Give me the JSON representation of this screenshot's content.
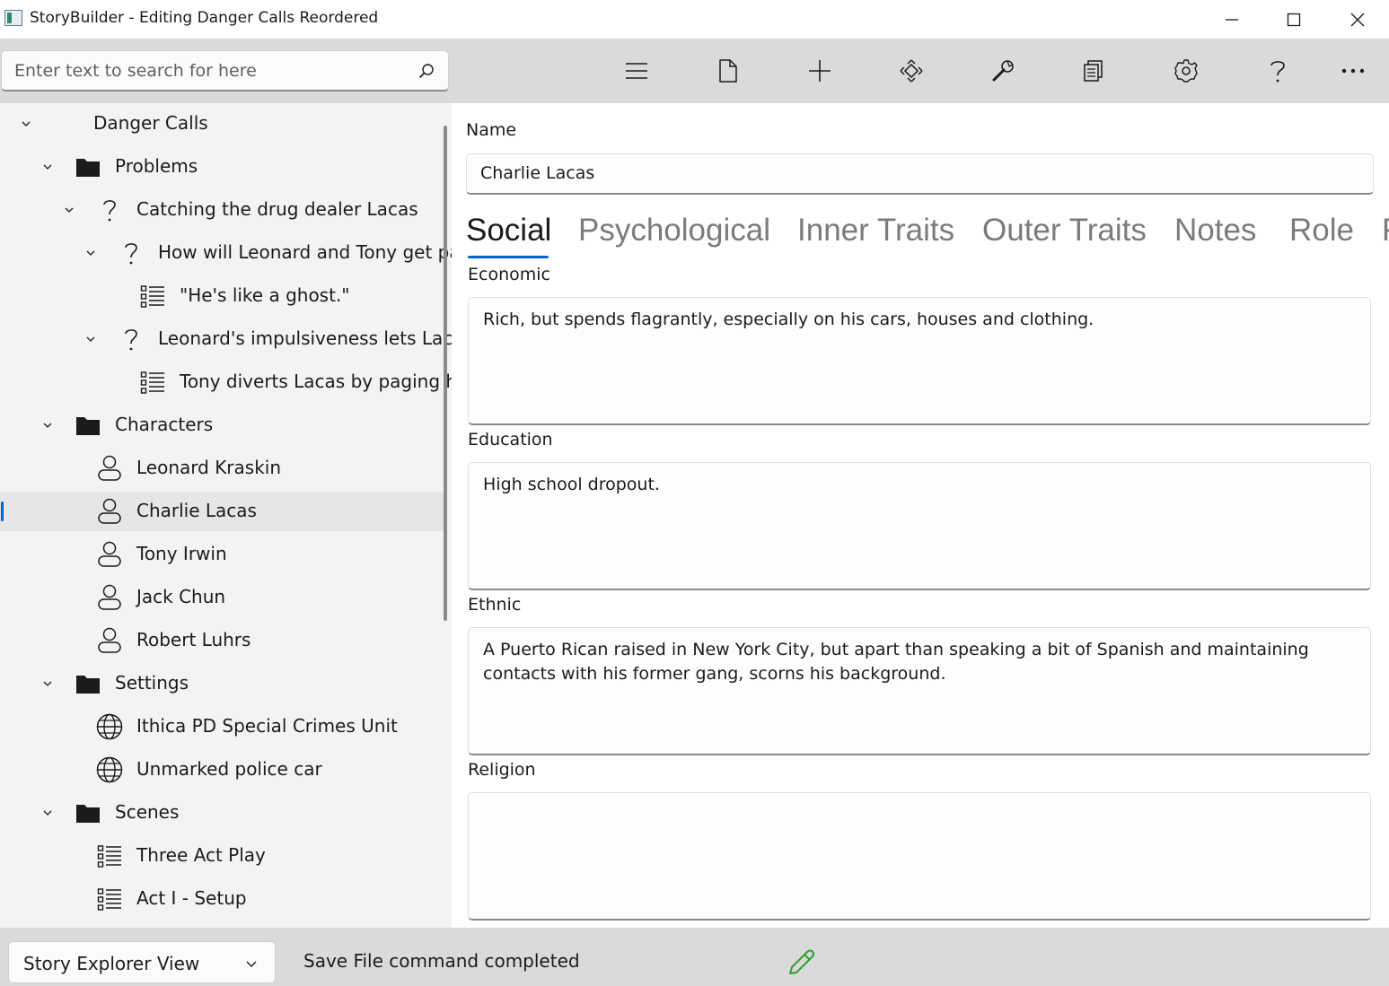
{
  "window": {
    "title": "StoryBuilder - Editing Danger Calls Reordered",
    "app_icon": "storybuilder-app-icon",
    "controls": [
      "minimize-icon",
      "maximize-icon",
      "close-icon"
    ]
  },
  "search": {
    "placeholder": "Enter text to search for here",
    "value": "",
    "icon": "search-icon"
  },
  "toolbar": {
    "buttons": [
      "menu-icon",
      "file-icon",
      "add-icon",
      "move-icon",
      "tools-icon",
      "reports-icon",
      "settings-icon",
      "help-icon",
      "more-icon"
    ]
  },
  "tree": {
    "nodes": [
      {
        "label": "Danger Calls",
        "icon": "none",
        "expanded": true
      },
      {
        "label": "Problems",
        "icon": "folder-icon",
        "expanded": true
      },
      {
        "label": "Catching the drug dealer Lacas",
        "icon": "question-icon",
        "expanded": true
      },
      {
        "label": "How will Leonard and Tony get past Lacas",
        "icon": "question-icon",
        "expanded": true
      },
      {
        "label": "\"He's like a ghost.\"",
        "icon": "scene-list-icon"
      },
      {
        "label": "Leonard's impulsiveness lets Lacas escape",
        "icon": "question-icon",
        "expanded": true
      },
      {
        "label": "Tony diverts Lacas by paging him",
        "icon": "scene-list-icon"
      },
      {
        "label": "Characters",
        "icon": "folder-icon",
        "expanded": true
      },
      {
        "label": "Leonard Kraskin",
        "icon": "person-icon"
      },
      {
        "label": "Charlie Lacas",
        "icon": "person-icon",
        "selected": true
      },
      {
        "label": "Tony Irwin",
        "icon": "person-icon"
      },
      {
        "label": "Jack Chun",
        "icon": "person-icon"
      },
      {
        "label": "Robert Luhrs",
        "icon": "person-icon"
      },
      {
        "label": "Settings",
        "icon": "folder-icon",
        "expanded": true
      },
      {
        "label": "Ithica PD Special Crimes Unit",
        "icon": "globe-icon"
      },
      {
        "label": "Unmarked police car",
        "icon": "globe-icon"
      },
      {
        "label": "Scenes",
        "icon": "folder-icon",
        "expanded": true
      },
      {
        "label": "Three Act Play",
        "icon": "scene-list-icon"
      },
      {
        "label": "Act I - Setup",
        "icon": "scene-list-icon"
      }
    ]
  },
  "editor": {
    "name_label": "Name",
    "name_value": "Charlie Lacas",
    "tabs": [
      {
        "label": "Social",
        "active": true
      },
      {
        "label": "Psychological"
      },
      {
        "label": "Inner Traits"
      },
      {
        "label": "Outer Traits"
      },
      {
        "label": "Notes"
      },
      {
        "label": "Role"
      },
      {
        "label": "F"
      }
    ],
    "fields": [
      {
        "label": "Economic",
        "value": "Rich, but spends flagrantly, especially on his cars, houses and clothing."
      },
      {
        "label": "Education",
        "value": "High school dropout."
      },
      {
        "label": "Ethnic",
        "value": "A Puerto Rican raised in New York City, but apart than speaking a bit of Spanish and maintaining contacts with his former gang, scorns his background."
      },
      {
        "label": "Religion",
        "value": ""
      }
    ]
  },
  "status": {
    "view_selected": "Story Explorer View",
    "message": "Save File command completed",
    "edit_indicator": "pencil-icon",
    "edit_color": "#2e9e2e"
  },
  "colors": {
    "accent": "#0067c0",
    "toolbar_bg": "#dadada"
  }
}
